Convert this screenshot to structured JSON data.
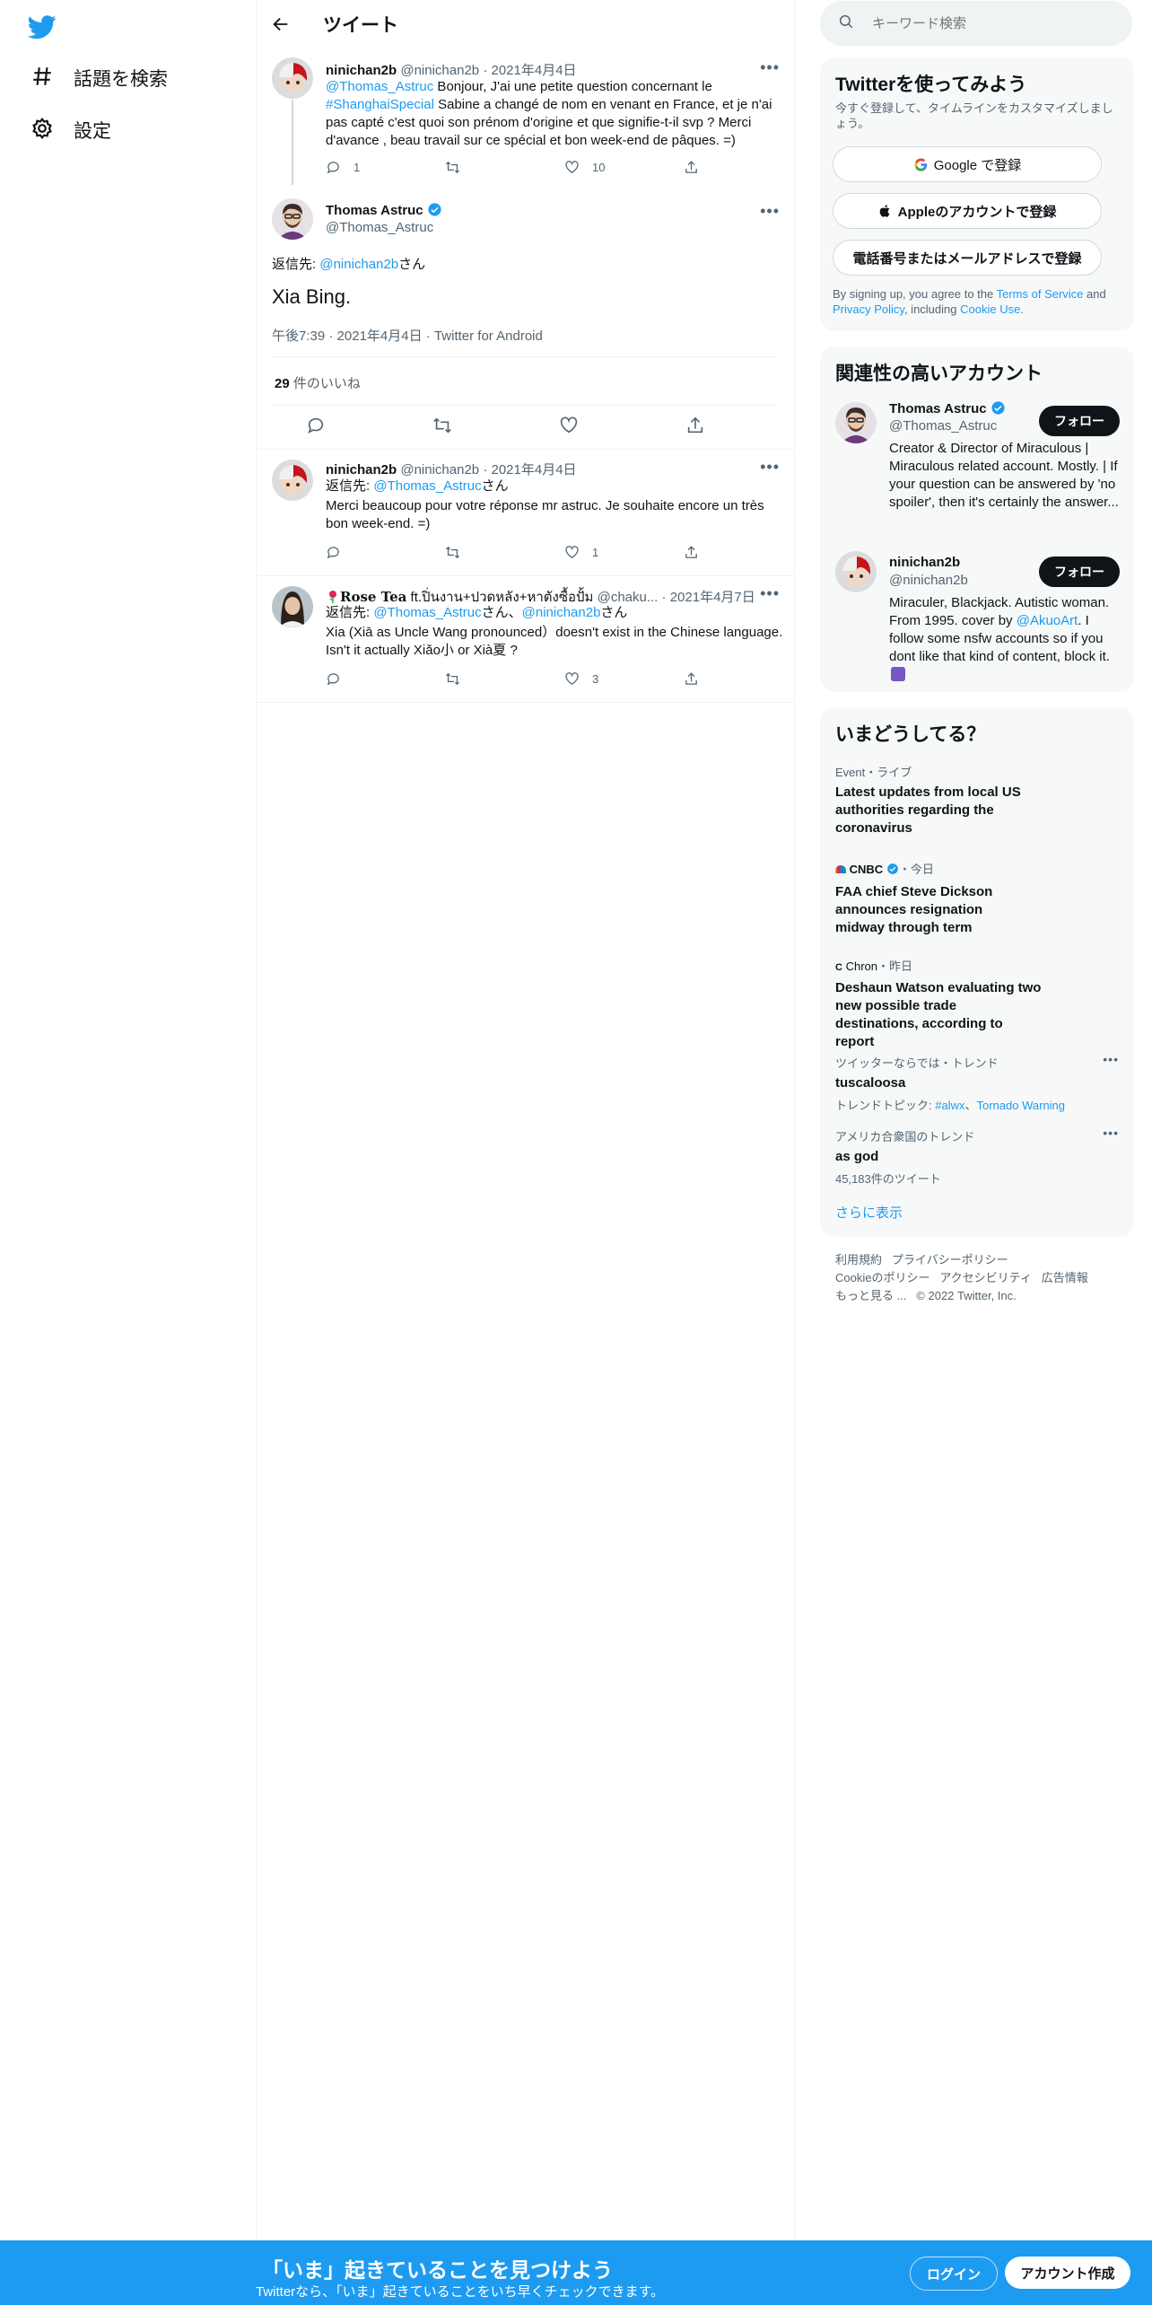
{
  "nav": {
    "items": [
      {
        "label": "話題を検索",
        "icon": "hashtag-icon"
      },
      {
        "label": "設定",
        "icon": "gear-icon"
      }
    ]
  },
  "main": {
    "header_title": "ツイート",
    "parent_tweet": {
      "name": "ninichan2b",
      "handle": "@ninichan2b",
      "date": "2021年4月4日",
      "mention": "@Thomas_Astruc",
      "text1": " Bonjour, J'ai une petite question concernant le ",
      "hashtag": "#ShanghaiSpecial",
      "text2": " Sabine a changé de nom en venant en France, et je n'ai pas capté c'est quoi son prénom d'origine et que signifie-t-il svp ? Merci d'avance , beau travail sur ce spécial et bon week-end de pâques. =)",
      "replies": "1",
      "likes": "10"
    },
    "focus_tweet": {
      "name": "Thomas Astruc",
      "handle": "@Thomas_Astruc",
      "reply_prefix": "返信先: ",
      "reply_to": "@ninichan2b",
      "reply_suffix": "さん",
      "text": "Xia Bing.",
      "time": "午後7:39",
      "date": "2021年4月4日",
      "source": "Twitter for Android",
      "like_count": "29",
      "like_label": " 件のいいね"
    },
    "replies": [
      {
        "name": "ninichan2b",
        "handle": "@ninichan2b",
        "date": "2021年4月4日",
        "reply_prefix": "返信先: ",
        "reply_to": "@Thomas_Astruc",
        "reply_suffix": "さん",
        "text": "Merci beaucoup pour votre réponse mr astruc. Je souhaite encore un très bon week-end. =)",
        "likes": "1"
      },
      {
        "name": "Rose Tea",
        "name_suffix": " ft.ปิ่นงาน+ปวดหลัง+หาตังซื้อปั้ม",
        "handle": "@chaku...",
        "date": "2021年4月7日",
        "reply_prefix": "返信先: ",
        "reply_to": "@Thomas_Astruc",
        "reply_mid": "さん、",
        "reply_to2": "@ninichan2b",
        "reply_suffix": "さん",
        "text": "Xia (Xiā as Uncle Wang pronounced）doesn't exist in the Chinese language. Isn't it actually Xiǎo小 or Xià夏 ?",
        "likes": "3"
      }
    ]
  },
  "sidebar": {
    "search_placeholder": "キーワード検索",
    "signup_card": {
      "title": "Twitterを使ってみよう",
      "subtitle": "今すぐ登録して、タイムラインをカスタマイズしましょう。",
      "google": "Google で登録",
      "apple": "Appleのアカウントで登録",
      "phone": "電話番号またはメールアドレスで登録",
      "legal1": "By signing up, you agree to the ",
      "tos": "Terms of Service",
      "legal2": " and ",
      "privacy": "Privacy Policy",
      "legal3": ", including ",
      "cookie": "Cookie Use",
      "legal4": "."
    },
    "accounts_card": {
      "title": "関連性の高いアカウント",
      "follow_label": "フォロー",
      "accounts": [
        {
          "name": "Thomas Astruc",
          "handle": "@Thomas_Astruc",
          "bio": "Creator & Director of Miraculous | Miraculous related account. Mostly. | If your question can be answered by 'no spoiler', then it's certainly the answer..."
        },
        {
          "name": "ninichan2b",
          "handle": "@ninichan2b",
          "bio1": "Miraculer, Blackjack. Autistic woman. From 1995. cover by ",
          "bio_link": "@AkuoArt",
          "bio2": ". I follow some nsfw accounts so if you dont like that kind of content, block it."
        }
      ]
    },
    "trends_card": {
      "title": "いまどうしてる？",
      "items": [
        {
          "meta": "Event・ライブ",
          "name": "Latest updates from local US authorities regarding the coronavirus"
        },
        {
          "source": "CNBC",
          "meta": "・今日",
          "name": "FAA chief Steve Dickson announces resignation midway through term"
        },
        {
          "source": "Chron",
          "meta": "・昨日",
          "name": "Deshaun Watson evaluating two new possible trade destinations, according to report"
        },
        {
          "meta": "ツイッターならでは・トレンド",
          "name": "tuscaloosa",
          "topic_prefix": "トレンドトピック: ",
          "topic1": "#alwx",
          "topic_sep": "、",
          "topic2": "Tornado Warning"
        },
        {
          "meta": "アメリカ合衆国のトレンド",
          "name": "as god",
          "count": "45,183件のツイート"
        }
      ],
      "show_more": "さらに表示"
    },
    "footer": {
      "row1": [
        "利用規約",
        "プライバシーポリシー"
      ],
      "row2": [
        "Cookieのポリシー",
        "アクセシビリティ",
        "広告情報"
      ],
      "more": "もっと見る ...",
      "copyright": "© 2022 Twitter, Inc."
    }
  },
  "bottom_bar": {
    "headline": "「いま」起きていることを見つけよう",
    "sub": "Twitterなら、「いま」起きていることをいち早くチェックできます。",
    "login": "ログイン",
    "signup": "アカウント作成"
  },
  "colors": {
    "accent": "#1d9bf0",
    "text": "#0f1419",
    "muted": "#536471",
    "like_pink": "#f91880"
  }
}
